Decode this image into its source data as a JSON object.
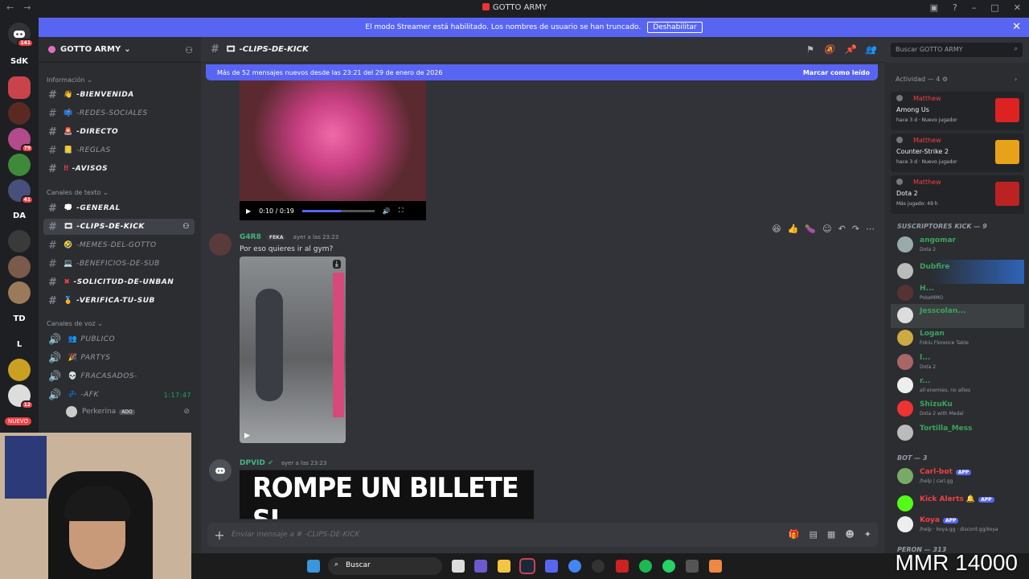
{
  "window": {
    "title": "GOTTO ARMY"
  },
  "banner": {
    "text": "El modo Streamer está habilitado. Los nombres de usuario se han truncado.",
    "button": "Deshabilitar"
  },
  "servers": [
    {
      "label": "SdK"
    },
    {
      "label": "DA"
    },
    {
      "label": "TD"
    },
    {
      "label": "L"
    }
  ],
  "server_badges": [
    "141",
    "79",
    "41",
    "12"
  ],
  "nuevo": "NUEVO",
  "guild": {
    "name": "GOTTO ARMY"
  },
  "categories": {
    "info": "Información",
    "text": "Canales de texto",
    "voice": "Canales de voz"
  },
  "info_channels": [
    "-BIENVENIDA",
    "-REDES-SOCIALES",
    "-DIRECTO",
    "-REGLAS",
    "-AVISOS"
  ],
  "text_channels": [
    "-GENERAL",
    "-CLIPS-DE-KICK",
    "-MEMES-DEL-GOTTO",
    "-BENEFICIOS-DE-SUB",
    "-SOLICITUD-DE-UNBAN",
    "-VERIFICA-TU-SUB"
  ],
  "voice_channels": [
    "PUBLICO",
    "PARTYS",
    "FRACASADOS-",
    "-AFK"
  ],
  "afk_timer": "1:17:47",
  "afk_user": {
    "name": "Perkerina",
    "tag": "ADO"
  },
  "channel": {
    "name": "-CLIPS-DE-KICK"
  },
  "new_messages": {
    "text": "Más de 52 mensajes nuevos desde las 23:21 del 29 de enero de 2026",
    "action": "Marcar como leído"
  },
  "media1": {
    "time": "0:10 / 0:19"
  },
  "messages": [
    {
      "author": "G4R8",
      "tag": "FEKA",
      "time": "ayer a las 23:23",
      "text": "Por eso quieres ir al gym?"
    },
    {
      "author": "DPVID",
      "time": "ayer a las 23:23",
      "meme_text": "ROMPE UN BILLETE SI"
    }
  ],
  "composer": {
    "placeholder": "Enviar mensaje a # -CLIPS-DE-KICK"
  },
  "members_search": "Buscar GOTTO ARMY",
  "activity": {
    "title": "Actividad — 4",
    "items": [
      {
        "user": "Matthew",
        "game": "Among Us",
        "meta": "hace 3 d  ·  Nuevo jugador"
      },
      {
        "user": "Matthew",
        "game": "Counter-Strike 2",
        "meta": "hace 3 d  ·  Nuevo jugador"
      },
      {
        "user": "Matthew",
        "game": "Dota 2",
        "meta": "Más jugado: 49 h"
      }
    ]
  },
  "sections": {
    "subs": "SUSCRIPTORES KICK — 9",
    "bot": "BOT — 3",
    "peron": "PERON — 313"
  },
  "subs": [
    {
      "name": "angomar",
      "status": "Dota 2",
      "color": "#23a55a"
    },
    {
      "name": "Dubfire",
      "status": "",
      "color": "#23a55a"
    },
    {
      "name": "H...",
      "status": "PokeMMO",
      "color": "#23a55a"
    },
    {
      "name": "Jesscolan...",
      "status": "",
      "color": "#23a55a"
    },
    {
      "name": "Logan",
      "status": "Fokiu Florence Table",
      "color": "#23a55a"
    },
    {
      "name": "l...",
      "status": "Dota 2",
      "color": "#23a55a"
    },
    {
      "name": "r...",
      "status": "all enemies, no allies",
      "color": "#23a55a"
    },
    {
      "name": "ShizuKu",
      "status": "Dota 2 with Medal",
      "color": "#23a55a"
    },
    {
      "name": "Tortilla_Mess",
      "status": "",
      "color": "#23a55a"
    }
  ],
  "bots": [
    {
      "name": "Carl-bot",
      "status": "/help | carl.gg",
      "app": "APP"
    },
    {
      "name": "Kick Alerts",
      "status": "",
      "app": "APP"
    },
    {
      "name": "Koya",
      "status": "/help · koya.gg · discord.gg/koya",
      "app": "APP"
    }
  ],
  "taskbar": {
    "search": "Buscar"
  },
  "overlay": {
    "mmr": "MMR 14000"
  }
}
